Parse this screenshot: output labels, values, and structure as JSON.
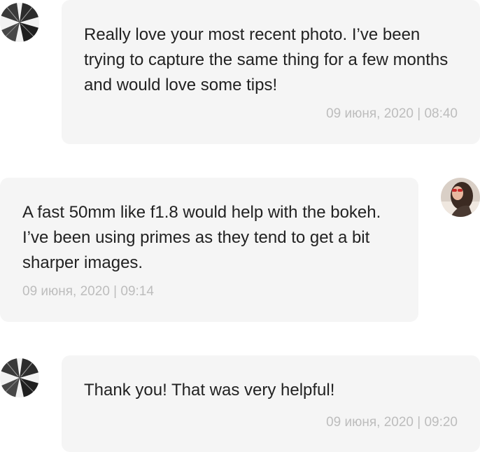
{
  "messages": [
    {
      "direction": "incoming",
      "avatar": "building-avatar",
      "text": "Really love your most recent photo. I’ve been trying to capture the same thing for a few months and would love some tips!",
      "time": "09 июня, 2020 | 08:40"
    },
    {
      "direction": "outgoing",
      "avatar": "woman-avatar",
      "text": "A fast 50mm like f1.8 would help with the bokeh. I’ve been using primes as they tend to get a bit sharper images.",
      "time": "09 июня, 2020 | 09:14"
    },
    {
      "direction": "incoming",
      "avatar": "building-avatar",
      "text": "Thank you! That was very helpful!",
      "time": "09 июня, 2020 | 09:20"
    }
  ],
  "colors": {
    "bubble_bg": "#f5f5f5",
    "text": "#222222",
    "timestamp": "#bdbdbd"
  }
}
